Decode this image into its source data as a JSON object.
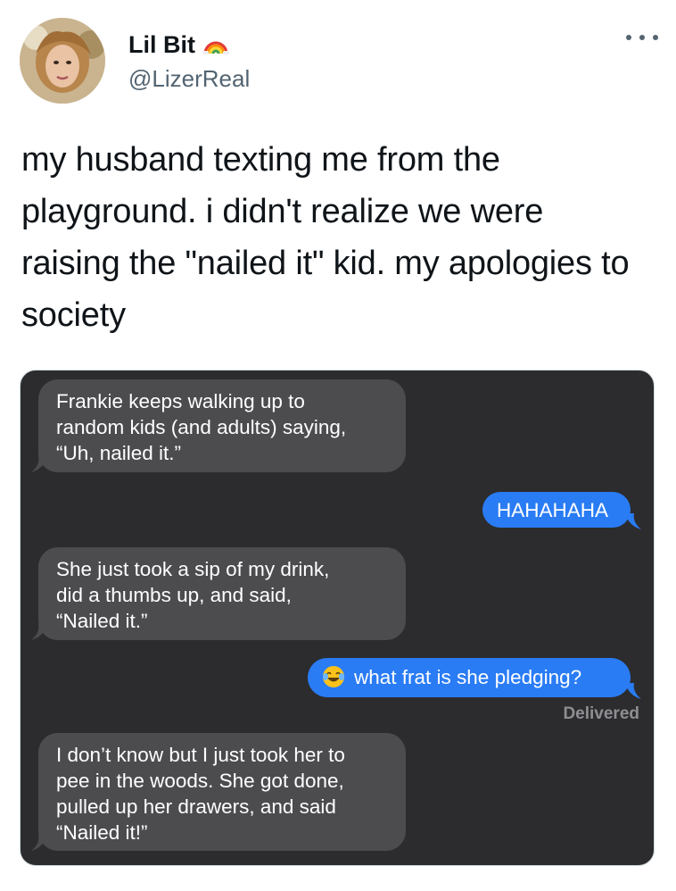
{
  "author": {
    "display_name": "Lil Bit",
    "handle": "@LizerReal"
  },
  "tweet": {
    "text": "my husband texting me from the playground. i didn't realize we were raising the \"nailed it\" kid. my apologies to society"
  },
  "messages": [
    {
      "from": "them",
      "lines": [
        "Frankie keeps walking up to",
        "random kids (and adults) saying,",
        "“Uh, nailed it.”"
      ]
    },
    {
      "from": "me",
      "lines": [
        "HAHAHAHA"
      ]
    },
    {
      "from": "them",
      "lines": [
        "She just took a sip of my drink,",
        "did a thumbs up, and said,",
        "“Nailed it.”"
      ]
    },
    {
      "from": "me",
      "lines": [
        "what frat is she pledging?"
      ],
      "emoji": "laughing-tears"
    },
    {
      "from": "them",
      "lines": [
        "I don’t know but I just took her to",
        "pee in the woods. She got done,",
        "pulled up her drawers, and said",
        "“Nailed it!”"
      ]
    }
  ],
  "status": {
    "delivered": "Delivered"
  },
  "colors": {
    "sent_bubble": "#2a7cf5",
    "recv_bubble": "#4c4c4f",
    "chat_bg": "#2c2c2e"
  }
}
